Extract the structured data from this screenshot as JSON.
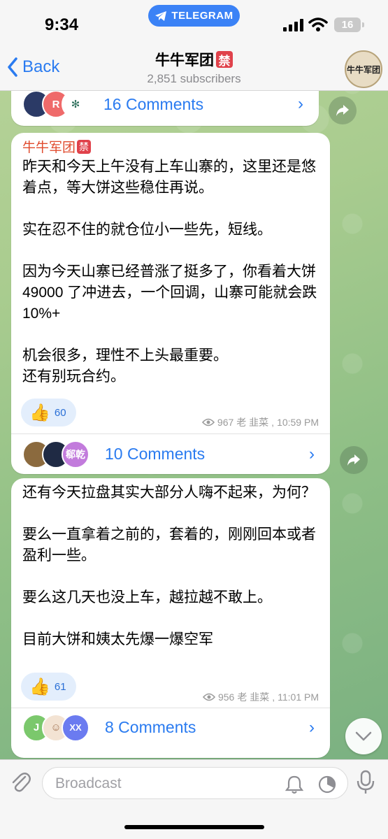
{
  "status": {
    "time": "9:34",
    "pill_label": "TELEGRAM",
    "battery": "16"
  },
  "header": {
    "back_label": "Back",
    "channel_name": "牛牛军团",
    "ban_glyph": "禁",
    "subscribers": "2,851 subscribers",
    "avatar_text": "牛牛军团"
  },
  "top_comments": {
    "avatars": [
      {
        "letter": "",
        "color": "#2b3a66"
      },
      {
        "letter": "R",
        "color": "#ef6a6a"
      },
      {
        "letter": "",
        "color": "#ffffff"
      }
    ],
    "label": "16 Comments"
  },
  "messages": [
    {
      "sender": "牛牛军团",
      "sender_badge": "禁",
      "text": "昨天和今天上午没有上车山寨的，这里还是悠着点，等大饼这些稳住再说。\n\n实在忍不住的就仓位小一些先，短线。\n\n因为今天山寨已经普涨了挺多了，你看着大饼 49000 了冲进去，一个回调，山寨可能就会跌 10%+\n\n机会很多，理性不上头最重要。\n还有别玩合约。",
      "reaction_emoji": "👍",
      "reaction_count": "60",
      "views": "967",
      "author": "老 韭菜",
      "time": "10:59 PM",
      "comments": {
        "avatars": [
          {
            "letter": "",
            "color": "#8b6a3e"
          },
          {
            "letter": "",
            "color": "#1f2a44"
          },
          {
            "letter": "郗乾",
            "color": "#c27bdc"
          }
        ],
        "label": "10 Comments"
      }
    },
    {
      "sender": "",
      "text": "还有今天拉盘其实大部分人嗨不起来，为何？\n\n要么一直拿着之前的，套着的，刚刚回本或者盈利一些。\n\n要么这几天也没上车，越拉越不敢上。\n\n目前大饼和姨太先爆一爆空军",
      "reaction_emoji": "👍",
      "reaction_count": "61",
      "views": "956",
      "author": "老 韭菜",
      "time": "11:01 PM",
      "comments": {
        "avatars": [
          {
            "letter": "J",
            "color": "#7bc86c"
          },
          {
            "letter": "",
            "color": "#f3e3d3"
          },
          {
            "letter": "XX",
            "color": "#6b7bf0"
          }
        ],
        "label": "8 Comments"
      }
    }
  ],
  "input": {
    "placeholder": "Broadcast"
  },
  "colors": {
    "accent": "#2a7bf0",
    "sender": "#e04b2e",
    "ban": "#e0424b",
    "reaction_bg": "#e3eefc"
  }
}
